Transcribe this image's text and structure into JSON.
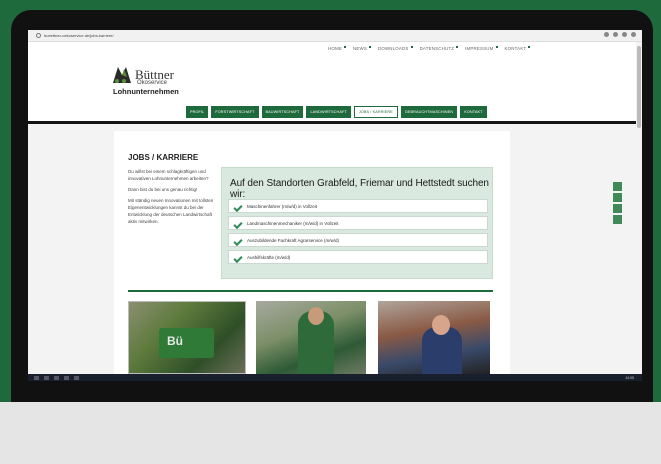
{
  "browser": {
    "url": "bueettner-oekoservice.de/jobs-karriere/"
  },
  "top_nav": [
    "HOME",
    "NEWS",
    "DOWNLOADS",
    "DATENSCHUTZ",
    "IMPRESSUM",
    "KONTAKT"
  ],
  "logo": {
    "name": "Büttner",
    "sub": "Ökoservice",
    "tagline": "Lohnunternehmen"
  },
  "main_nav": [
    {
      "label": "PROFIL"
    },
    {
      "label": "FORSTWIRTSCHAFT"
    },
    {
      "label": "BAUWIRTSCHAFT"
    },
    {
      "label": "LANDWIRTSCHAFT"
    },
    {
      "label": "JOBS / KARRIERE",
      "active": true
    },
    {
      "label": "GEBRAUCHTMASCHINEN"
    },
    {
      "label": "KONTAKT"
    }
  ],
  "page": {
    "heading": "JOBS / KARRIERE",
    "intro": [
      "Du willst bei einem schlagkräftigen und innovativen Lohnunternehmen arbeiten?",
      "Dann bist du bei uns genau richtig!",
      "Mit ständig neuen Innovationen mit tollsten Eigenentwicklungen kannst du bei der Entwicklung der deutschen Landwirtschaft aktiv mitwirken."
    ],
    "jobs_title": "Auf den Standorten Grabfeld, Friemar und Hettstedt suchen wir:",
    "jobs": [
      "Maschinenfahrer (m/w/d) in Vollzeit",
      "Landmaschinenmechaniker (m/w/d) in Vollzeit",
      "Auszubildende Fachkraft Agrarservice (m/w/d)",
      "Aushilfskräfte (m/w/d)"
    ]
  },
  "photos": [
    "tractor-photo",
    "worker-photo",
    "mechanic-photo"
  ],
  "social": [
    "facebook-icon",
    "xing-icon",
    "instagram-icon",
    "youtube-icon"
  ],
  "taskbar": {
    "clock": "14:05"
  },
  "colors": {
    "brand_green": "#1f6a3c",
    "jobs_bg": "#d9e9df",
    "check": "#2e8b57"
  }
}
